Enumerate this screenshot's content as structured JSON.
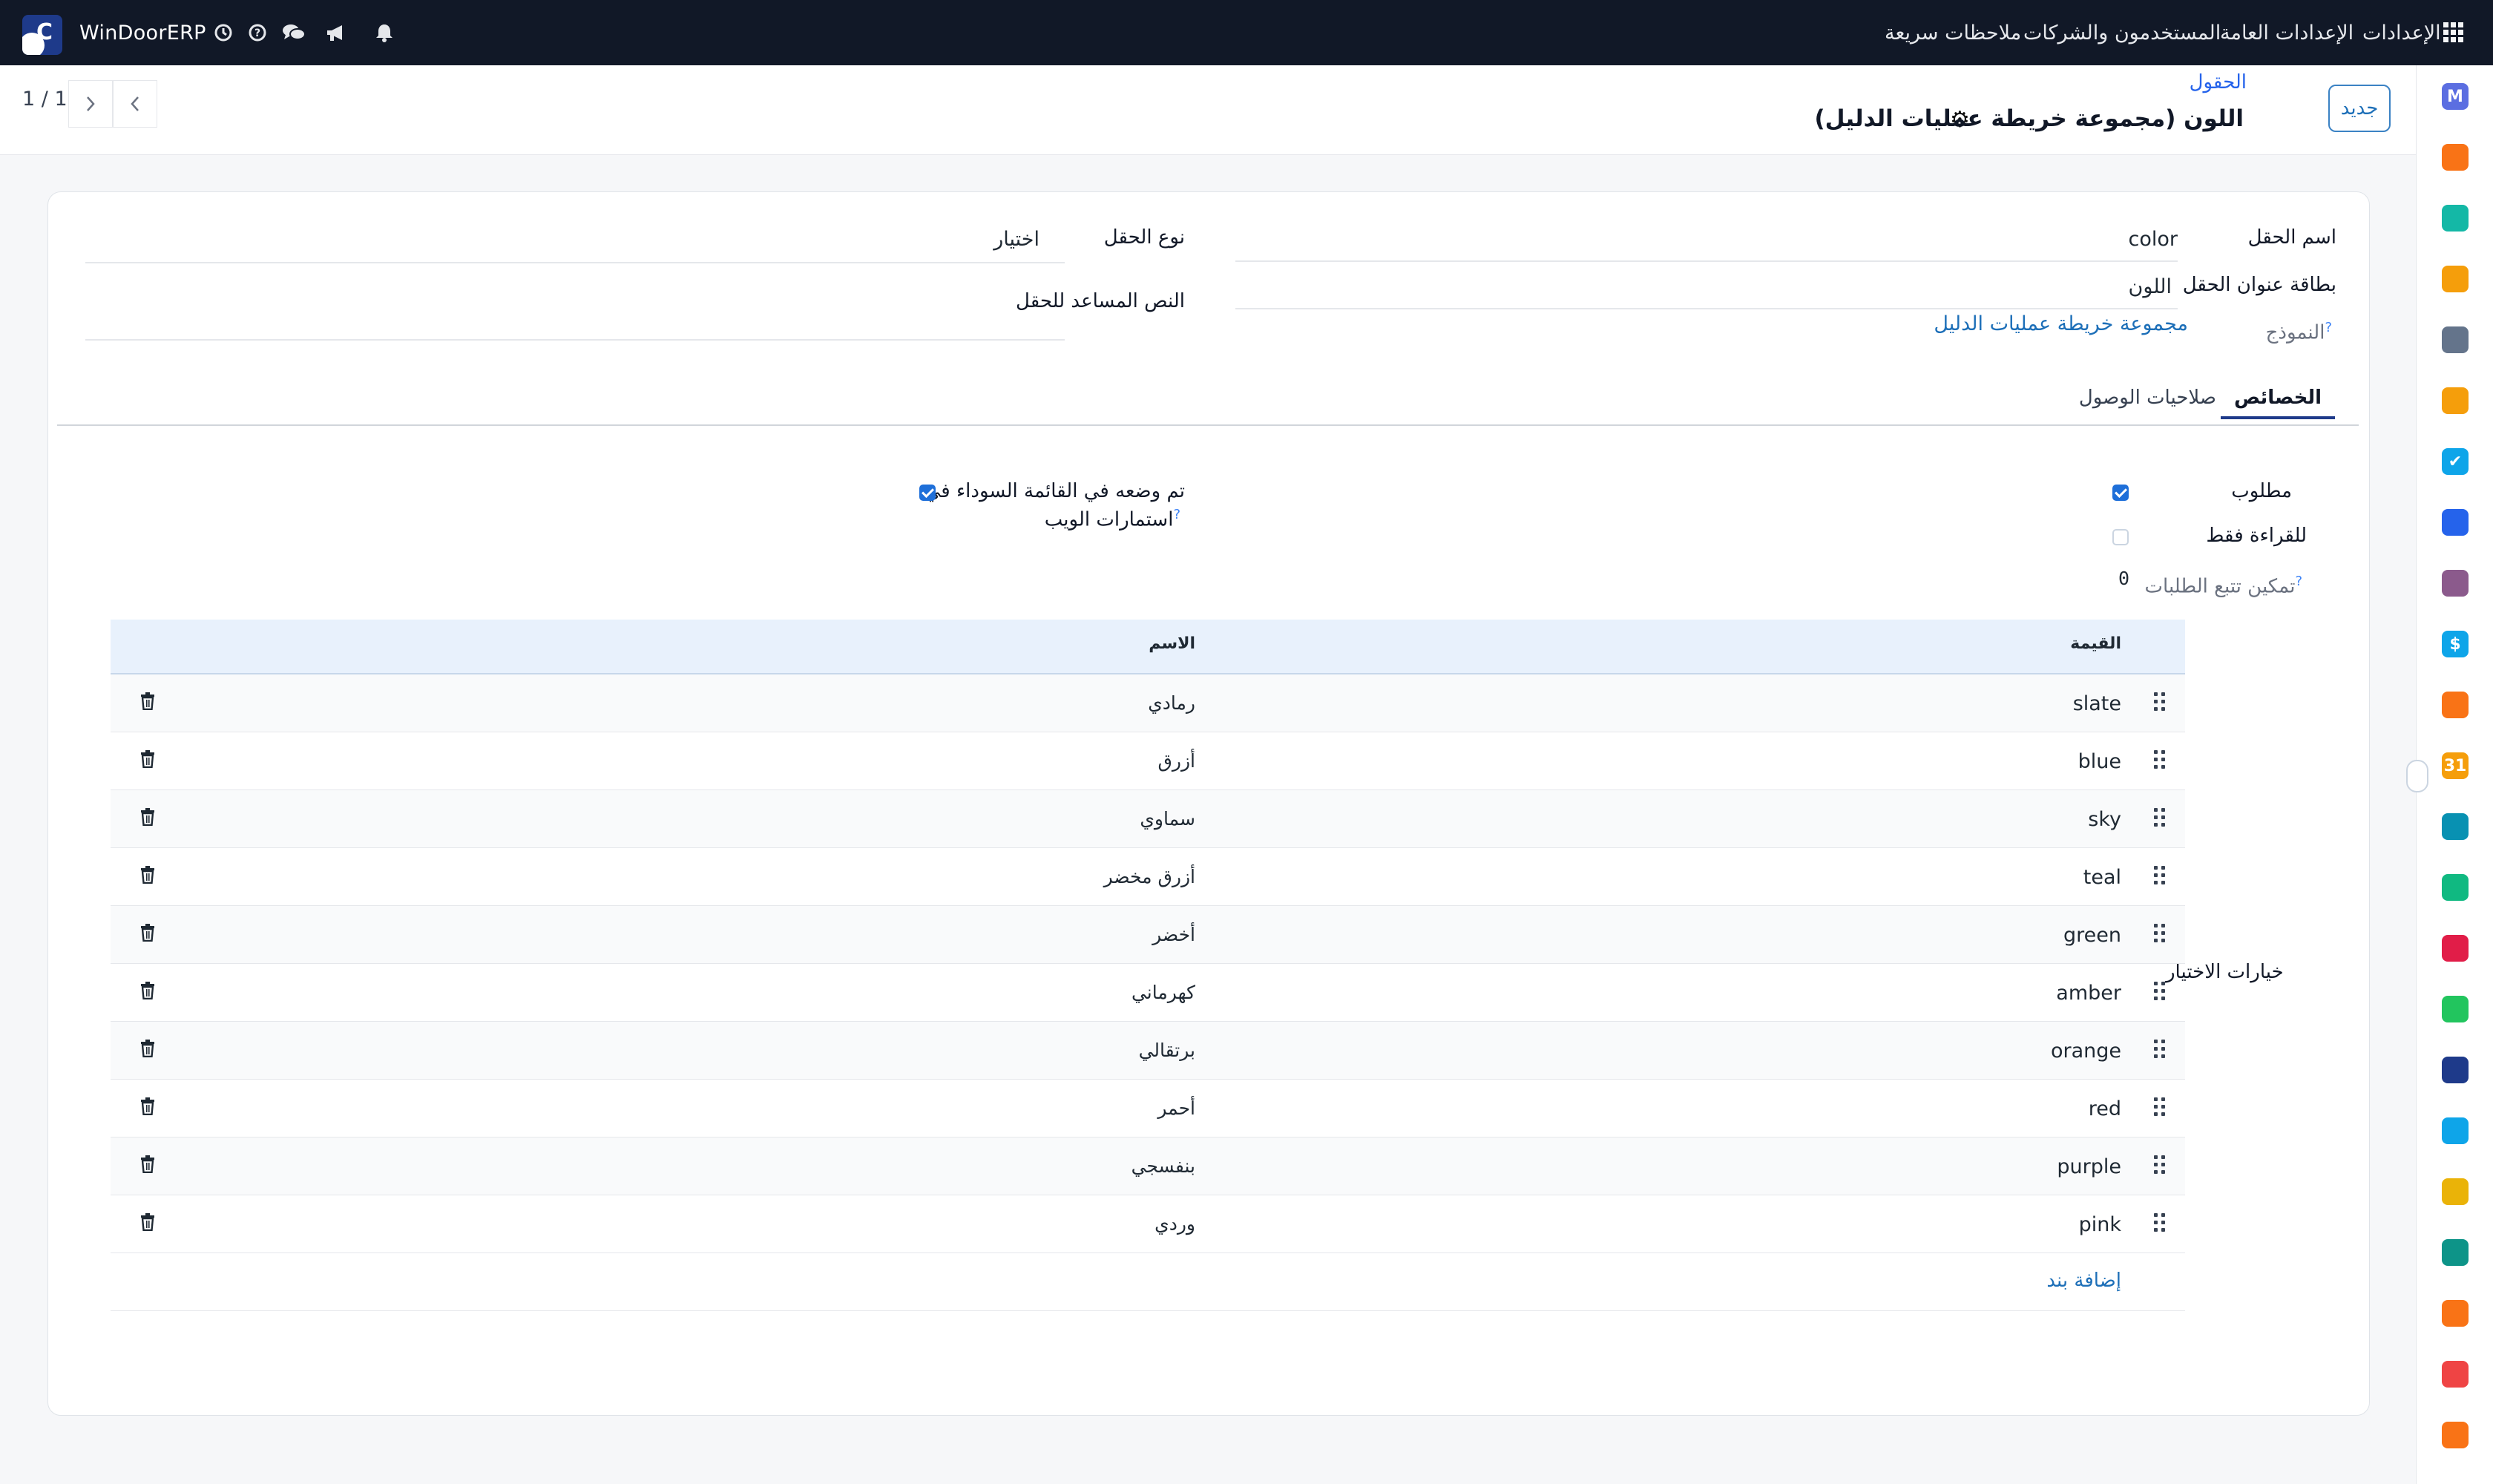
{
  "navbar": {
    "app_name": "WinDoorERP",
    "menus": [
      "الإعدادات",
      "الإعدادات العامة",
      "المستخدمون والشركات",
      "ملاحظات سريعة"
    ],
    "icons": [
      "apps-grid-icon",
      "bell-icon",
      "megaphone-icon",
      "chat-icon",
      "help-icon",
      "clock-icon"
    ]
  },
  "control": {
    "new_label": "جديد",
    "breadcrumb": "الحقول",
    "title": "اللون (مجموعة خريطة عمليات الدليل)",
    "pager": "1 / 1"
  },
  "form": {
    "field_name_label": "اسم الحقل",
    "field_name_value": "color",
    "field_label_label": "بطاقة عنوان الحقل",
    "field_label_value": "اللون",
    "model_label": "النموذج",
    "model_value": "مجموعة خريطة عمليات الدليل",
    "field_type_label": "نوع الحقل",
    "field_type_value": "اختيار",
    "help_label": "النص المساعد للحقل",
    "help_value": ""
  },
  "tabs": {
    "properties": "الخصائص",
    "access": "صلاحيات الوصول"
  },
  "properties": {
    "required_label": "مطلوب",
    "required": true,
    "readonly_label": "للقراءة فقط",
    "readonly": false,
    "tracking_label": "تمكين تتبع الطلبات",
    "tracking_value": "0",
    "blacklist_label_1": "تم وضعه في القائمة السوداء في",
    "blacklist_label_2": "استمارات الويب",
    "blacklisted": true,
    "selection_label": "خيارات الاختيار"
  },
  "table": {
    "col_value": "القيمة",
    "col_name": "الاسم",
    "rows": [
      {
        "value": "slate",
        "name": "رمادي"
      },
      {
        "value": "blue",
        "name": "أزرق"
      },
      {
        "value": "sky",
        "name": "سماوي"
      },
      {
        "value": "teal",
        "name": "أزرق مخضر"
      },
      {
        "value": "green",
        "name": "أخضر"
      },
      {
        "value": "amber",
        "name": "كهرماني"
      },
      {
        "value": "orange",
        "name": "برتقالي"
      },
      {
        "value": "red",
        "name": "أحمر"
      },
      {
        "value": "purple",
        "name": "بنفسجي"
      },
      {
        "value": "pink",
        "name": "وردي"
      }
    ],
    "add_line": "إضافة بند"
  },
  "sidebar_apps": [
    {
      "icon": "mail-marketing-icon",
      "color": "#5b6ee1",
      "glyph": "M"
    },
    {
      "icon": "chat-bubble-icon",
      "color": "#f97316",
      "glyph": ""
    },
    {
      "icon": "inventory-icon",
      "color": "#14b8a6",
      "glyph": ""
    },
    {
      "icon": "reporting-icon",
      "color": "#f59e0b",
      "glyph": ""
    },
    {
      "icon": "cube-icon",
      "color": "#64748b",
      "glyph": ""
    },
    {
      "icon": "sign-icon",
      "color": "#f59e0b",
      "glyph": ""
    },
    {
      "icon": "checkmark-icon",
      "color": "#0ea5e9",
      "glyph": "✔"
    },
    {
      "icon": "knowledge-icon",
      "color": "#2563eb",
      "glyph": ""
    },
    {
      "icon": "product-box-icon",
      "color": "#8b5a8c",
      "glyph": ""
    },
    {
      "icon": "invoicing-icon",
      "color": "#0ea5e9",
      "glyph": "$"
    },
    {
      "icon": "employees-icon",
      "color": "#f97316",
      "glyph": ""
    },
    {
      "icon": "calendar-icon",
      "color": "#f59e0b",
      "glyph": "31"
    },
    {
      "icon": "pen-icon",
      "color": "#0891b2",
      "glyph": ""
    },
    {
      "icon": "contacts-icon",
      "color": "#10b981",
      "glyph": ""
    },
    {
      "icon": "dashboard-tiles-icon",
      "color": "#e11d48",
      "glyph": ""
    },
    {
      "icon": "whatsapp-icon",
      "color": "#22c55e",
      "glyph": ""
    },
    {
      "icon": "gauge-icon",
      "color": "#1e3a8a",
      "glyph": ""
    },
    {
      "icon": "discuss-wave-icon",
      "color": "#0ea5e9",
      "glyph": ""
    },
    {
      "icon": "paper-plane-icon",
      "color": "#eab308",
      "glyph": ""
    },
    {
      "icon": "layers-icon",
      "color": "#0d9488",
      "glyph": ""
    },
    {
      "icon": "hexagon-icon",
      "color": "#f97316",
      "glyph": ""
    },
    {
      "icon": "pie-icon",
      "color": "#ef4444",
      "glyph": ""
    },
    {
      "icon": "settings-hex-icon",
      "color": "#f97316",
      "glyph": ""
    }
  ]
}
